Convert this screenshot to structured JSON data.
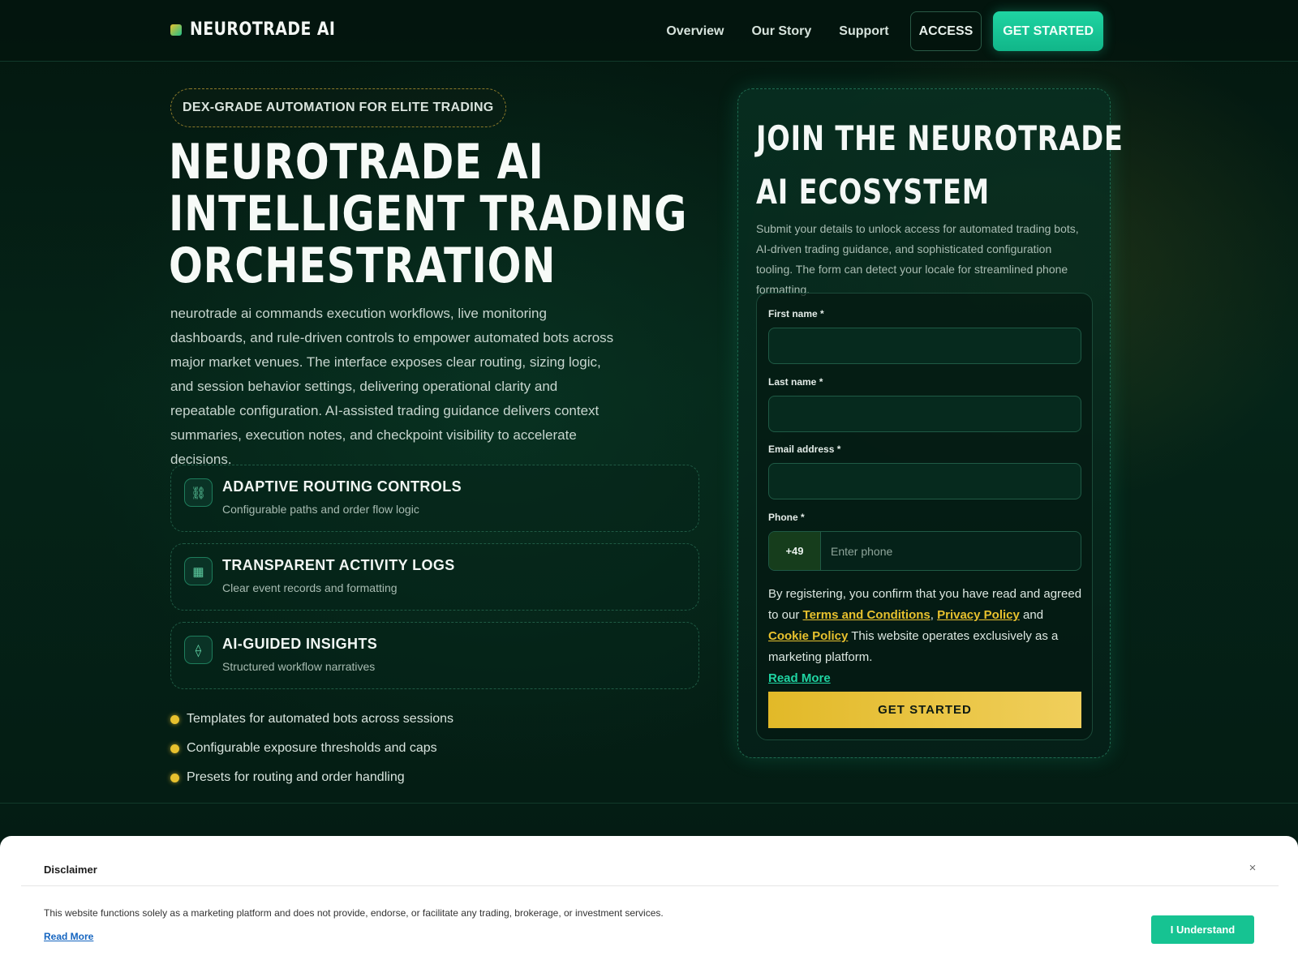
{
  "brand": {
    "name": "NEUROTRADE AI"
  },
  "nav": {
    "items": [
      "Overview",
      "Our Story",
      "Support"
    ],
    "access_label": "ACCESS",
    "cta_label": "GET STARTED"
  },
  "hero": {
    "pill": "DEX-GRADE AUTOMATION FOR ELITE TRADING",
    "title_lines": [
      "NEUROTRADE AI",
      "INTELLIGENT TRADING",
      "ORCHESTRATION"
    ],
    "description": "neurotrade ai commands execution workflows, live monitoring dashboards, and rule-driven controls to empower automated bots across major market venues. The interface exposes clear routing, sizing logic, and session behavior settings, delivering operational clarity and repeatable configuration. AI-assisted trading guidance delivers context summaries, execution notes, and checkpoint visibility to accelerate decisions.",
    "features": [
      {
        "icon": "link-icon",
        "glyph": "⛓",
        "title": "ADAPTIVE ROUTING CONTROLS",
        "subtitle": "Configurable paths and order flow logic"
      },
      {
        "icon": "grid-icon",
        "glyph": "▦",
        "title": "TRANSPARENT ACTIVITY LOGS",
        "subtitle": "Clear event records and formatting"
      },
      {
        "icon": "diamond-icon",
        "glyph": "⟠",
        "title": "AI-GUIDED INSIGHTS",
        "subtitle": "Structured workflow narratives"
      }
    ],
    "bullets": [
      "Templates for automated bots across sessions",
      "Configurable exposure thresholds and caps",
      "Presets for routing and order handling"
    ]
  },
  "form": {
    "title_lines": [
      "JOIN THE NEUROTRADE",
      "AI ECOSYSTEM"
    ],
    "description": "Submit your details to unlock access for automated trading bots, AI-driven trading guidance, and sophisticated configuration tooling. The form can detect your locale for streamlined phone formatting.",
    "first_name_label": "First name *",
    "first_name_value": "",
    "last_name_label": "Last name *",
    "last_name_value": "",
    "email_label": "Email address *",
    "email_value": "",
    "phone_label": "Phone *",
    "phone_code": "+49",
    "phone_placeholder": "Enter phone",
    "consent_prefix": "By registering, you confirm that you have read and agreed to our ",
    "terms": "Terms and Conditions",
    "comma": ", ",
    "privacy": "Privacy Policy",
    "and": " and ",
    "cookie": "Cookie Policy",
    "consent_suffix": " This website operates exclusively as a marketing platform.",
    "read_more": "Read More",
    "submit_label": "GET STARTED"
  },
  "disclaimer": {
    "title": "Disclaimer",
    "close": "×",
    "text": "This website functions solely as a marketing platform and does not provide, endorse, or facilitate any trading, brokerage, or investment services.",
    "read_more": "Read More",
    "button": "I Understand"
  },
  "colors": {
    "accent_teal": "#1fd4a2",
    "accent_gold": "#e8c12e",
    "background": "#041a13"
  }
}
